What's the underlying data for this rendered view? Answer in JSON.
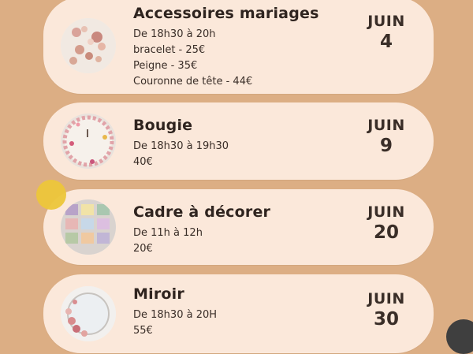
{
  "events": [
    {
      "title": "Accessoires mariages",
      "lines": [
        "De 18h30 à 20h",
        "bracelet - 25€",
        "Peigne - 35€",
        "Couronne de tête - 44€"
      ],
      "month": "JUIN",
      "day": "4"
    },
    {
      "title": "Bougie",
      "lines": [
        "De 18h30 à 19h30",
        "40€"
      ],
      "month": "JUIN",
      "day": "9"
    },
    {
      "title": "Cadre à décorer",
      "lines": [
        "De 11h à 12h",
        "20€"
      ],
      "month": "JUIN",
      "day": "20"
    },
    {
      "title": "Miroir",
      "lines": [
        "De 18h30 à 20H",
        "55€"
      ],
      "month": "JUIN",
      "day": "30"
    }
  ],
  "colors": {
    "background": "#dcae84",
    "card": "#fbe8da",
    "accent_dot": "#ecc63a"
  }
}
